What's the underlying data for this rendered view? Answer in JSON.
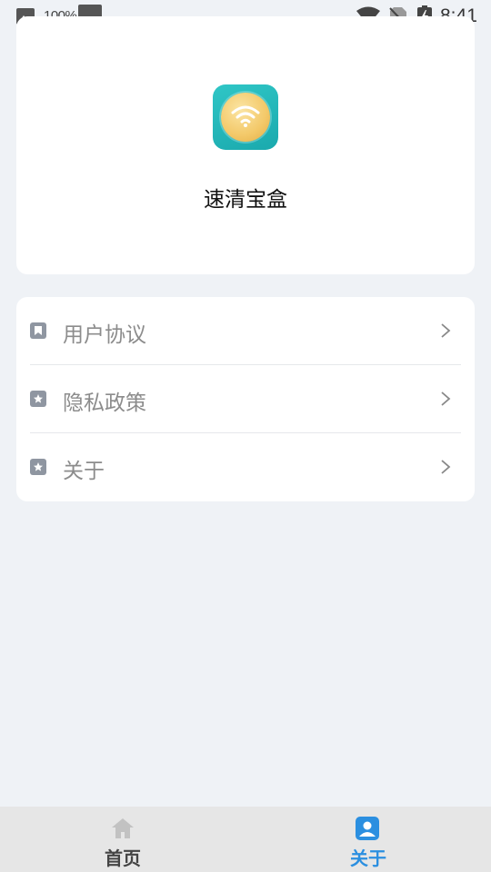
{
  "status_bar": {
    "battery_percent": "100%",
    "time": "8:41",
    "icons": [
      "image-icon",
      "wifi-icon",
      "no-sim-icon",
      "battery-charging-icon"
    ]
  },
  "app": {
    "name": "速清宝盒",
    "icon": "wifi-coin-app-icon"
  },
  "menu": {
    "items": [
      {
        "label": "用户协议",
        "icon": "bookmark-icon"
      },
      {
        "label": "隐私政策",
        "icon": "star-badge-icon"
      },
      {
        "label": "关于",
        "icon": "star-badge-icon"
      }
    ]
  },
  "tab_bar": {
    "tabs": [
      {
        "label": "首页",
        "icon": "home-icon",
        "active": false
      },
      {
        "label": "关于",
        "icon": "profile-icon",
        "active": true
      }
    ],
    "active_color": "#2b8fe0",
    "inactive_color": "#444444"
  },
  "colors": {
    "background": "#eff2f6",
    "card": "#ffffff",
    "menu_text": "#8c8c8c"
  }
}
